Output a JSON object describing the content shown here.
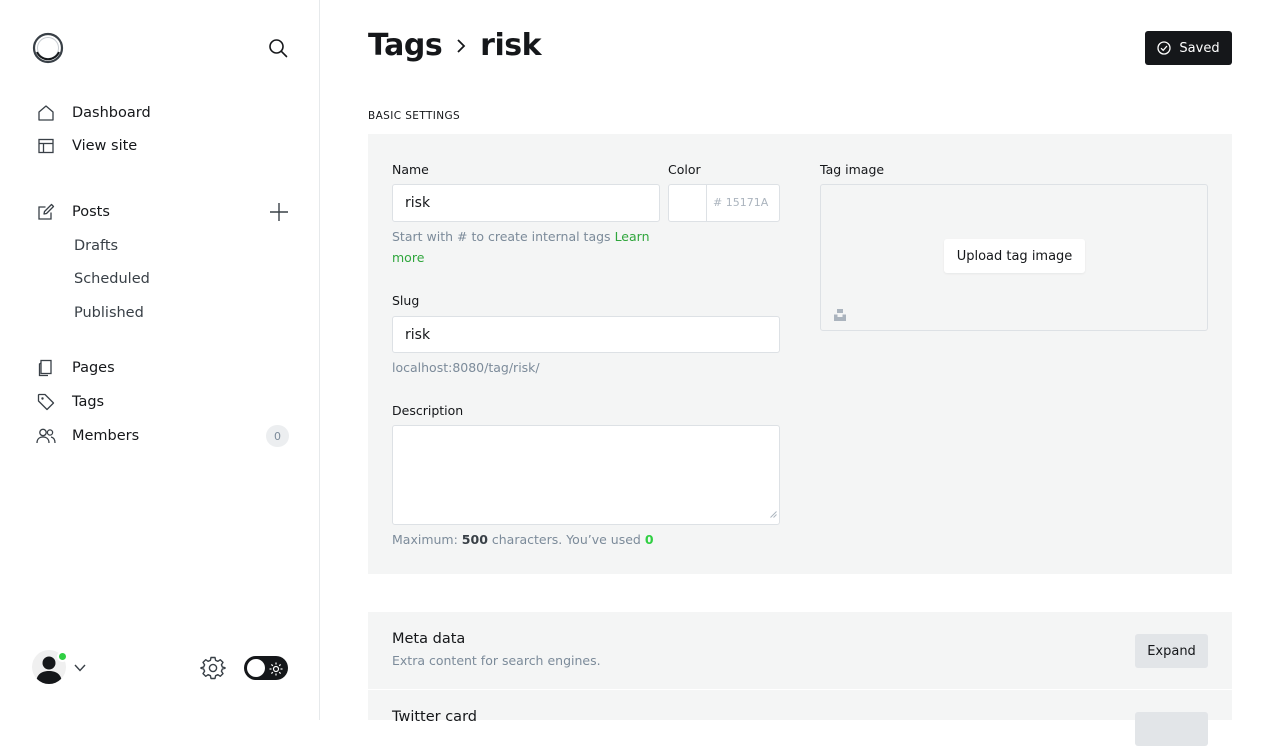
{
  "sidebar": {
    "nav": [
      {
        "label": "Dashboard",
        "icon": "home-icon"
      },
      {
        "label": "View site",
        "icon": "browser-icon"
      }
    ],
    "posts": {
      "label": "Posts",
      "icon": "edit-icon"
    },
    "post_sub": [
      {
        "label": "Drafts"
      },
      {
        "label": "Scheduled"
      },
      {
        "label": "Published"
      }
    ],
    "pages": {
      "label": "Pages",
      "icon": "pages-icon"
    },
    "tags": {
      "label": "Tags",
      "icon": "tag-icon"
    },
    "members": {
      "label": "Members",
      "icon": "members-icon",
      "count": "0"
    },
    "online_color": "#30cf43"
  },
  "header": {
    "breadcrumb_parent": "Tags",
    "breadcrumb_current": "risk",
    "saved_label": "Saved"
  },
  "basic": {
    "section_label": "BASIC SETTINGS",
    "name_label": "Name",
    "name_value": "risk",
    "name_hint": "Start with # to create internal tags",
    "learn_more": "Learn more",
    "color_label": "Color",
    "color_hash": "#",
    "color_placeholder": "15171A",
    "slug_label": "Slug",
    "slug_value": "risk",
    "slug_url": "localhost:8080/tag/risk/",
    "description_label": "Description",
    "max_prefix": "Maximum:",
    "max_value": "500",
    "max_mid": "characters. You’ve used",
    "used_value": "0",
    "tag_image_label": "Tag image",
    "upload_label": "Upload tag image"
  },
  "meta": {
    "title": "Meta data",
    "subtitle": "Extra content for search engines.",
    "expand_label": "Expand"
  },
  "twitter": {
    "title": "Twitter card"
  },
  "colors": {
    "accent_green": "#30a63d",
    "dark": "#15171a",
    "panel_bg": "#f4f5f5"
  }
}
